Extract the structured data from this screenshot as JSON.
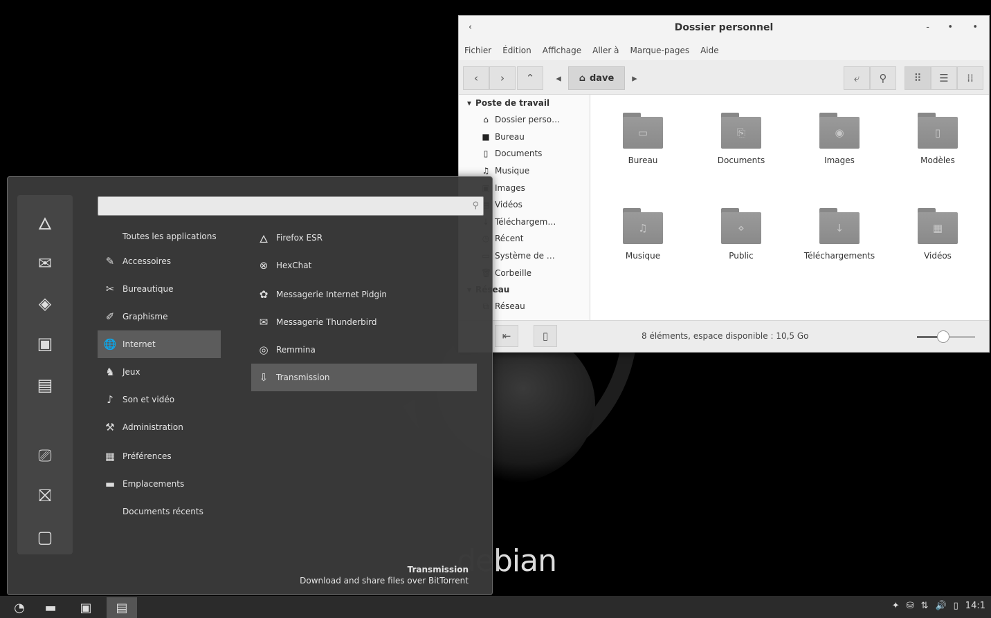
{
  "desktop": {
    "brand_dim": "de",
    "brand": "bian"
  },
  "file_manager": {
    "title": "Dossier personnel",
    "controls": {
      "back": "‹",
      "minimize": "-",
      "maximize": "•",
      "close": "•"
    },
    "menu": [
      "Fichier",
      "Édition",
      "Affichage",
      "Aller à",
      "Marque-pages",
      "Aide"
    ],
    "toolbar": {
      "location": "dave"
    },
    "sidebar": {
      "section": "Poste de travail",
      "items": [
        {
          "label": "Dossier perso…",
          "icon": "home-icon"
        },
        {
          "label": "Bureau",
          "icon": "desktop-folder-icon"
        },
        {
          "label": "Documents",
          "icon": "document-icon"
        },
        {
          "label": "Musique",
          "icon": "music-icon"
        },
        {
          "label": "Images",
          "icon": "image-icon"
        },
        {
          "label": "Vidéos",
          "icon": "video-icon"
        },
        {
          "label": "Téléchargem…",
          "icon": "download-icon"
        },
        {
          "label": "Récent",
          "icon": "recent-icon"
        },
        {
          "label": "Système de …",
          "icon": "drive-icon"
        },
        {
          "label": "Corbeille",
          "icon": "trash-icon"
        }
      ],
      "section2": "Réseau",
      "items2": [
        {
          "label": "Réseau",
          "icon": "network-icon"
        }
      ]
    },
    "items": [
      {
        "label": "Bureau",
        "glyph": "▭"
      },
      {
        "label": "Documents",
        "glyph": "⎘"
      },
      {
        "label": "Images",
        "glyph": "◉"
      },
      {
        "label": "Modèles",
        "glyph": "▯"
      },
      {
        "label": "Musique",
        "glyph": "♫"
      },
      {
        "label": "Public",
        "glyph": "⋄"
      },
      {
        "label": "Téléchargements",
        "glyph": "↓"
      },
      {
        "label": "Vidéos",
        "glyph": "▦"
      }
    ],
    "status": "8 éléments, espace disponible : 10,5 Go",
    "zoom_level": 0.45
  },
  "whisker_menu": {
    "search": {
      "value": "",
      "placeholder": ""
    },
    "categories": [
      {
        "label": "Toutes les applications",
        "icon": ""
      },
      {
        "label": "Accessoires",
        "icon": "accessories-icon"
      },
      {
        "label": "Bureautique",
        "icon": "office-icon"
      },
      {
        "label": "Graphisme",
        "icon": "graphics-icon"
      },
      {
        "label": "Internet",
        "icon": "internet-icon",
        "active": true
      },
      {
        "label": "Jeux",
        "icon": "games-icon"
      },
      {
        "label": "Son et vidéo",
        "icon": "multimedia-icon"
      },
      {
        "label": "Administration",
        "icon": "admin-icon"
      },
      {
        "label": "Préférences",
        "icon": "settings-icon"
      },
      {
        "label": "Emplacements",
        "icon": "places-icon"
      },
      {
        "label": "Documents récents",
        "icon": ""
      }
    ],
    "apps": [
      {
        "label": "Firefox ESR",
        "icon": "firefox-icon"
      },
      {
        "label": "HexChat",
        "icon": "hexchat-icon"
      },
      {
        "label": "Messagerie Internet Pidgin",
        "icon": "pidgin-icon"
      },
      {
        "label": "Messagerie Thunderbird",
        "icon": "thunderbird-icon"
      },
      {
        "label": "Remmina",
        "icon": "remmina-icon"
      },
      {
        "label": "Transmission",
        "icon": "transmission-icon",
        "active": true
      }
    ],
    "description": {
      "name": "Transmission",
      "text": "Download and share files over BitTorrent"
    }
  },
  "panel": {
    "clock": "14:1"
  }
}
